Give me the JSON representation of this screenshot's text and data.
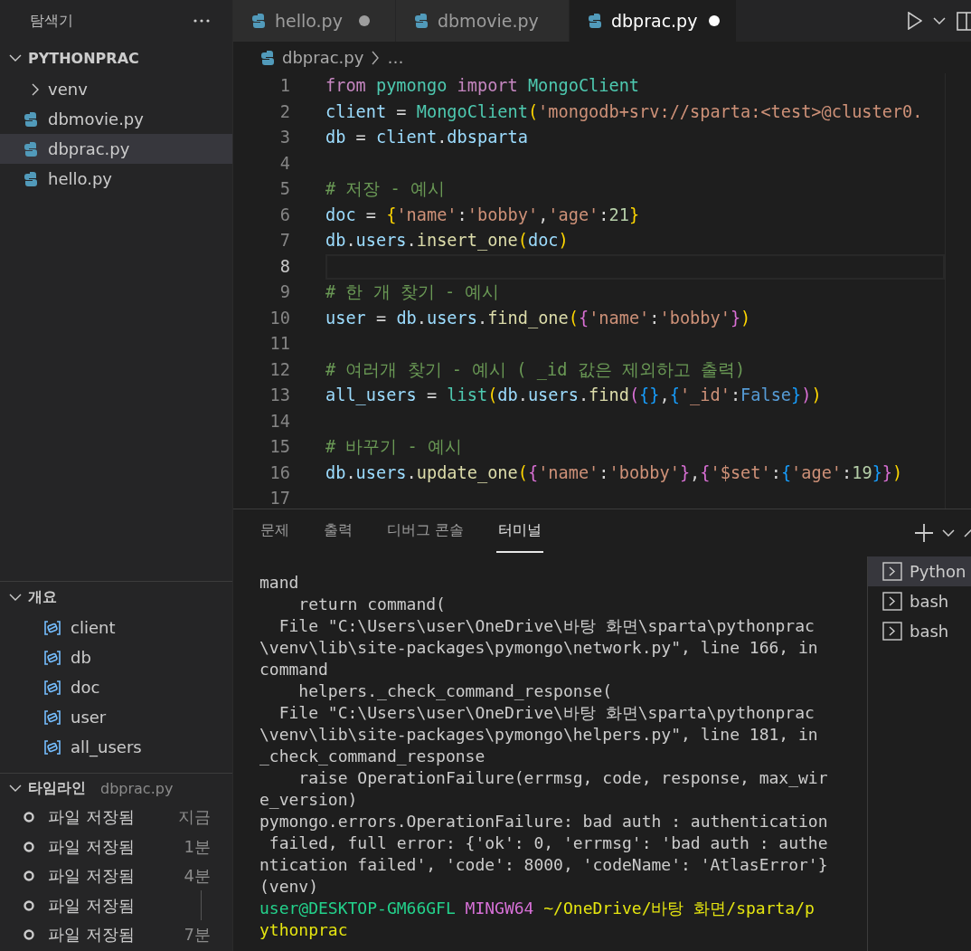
{
  "sidebar": {
    "title": "탐색기"
  },
  "explorer": {
    "folder": "PYTHONPRAC",
    "expanded": true,
    "items": [
      {
        "name": "venv",
        "kind": "folder",
        "expanded": false,
        "selected": false
      },
      {
        "name": "dbmovie.py",
        "kind": "file",
        "selected": false
      },
      {
        "name": "dbprac.py",
        "kind": "file",
        "selected": true
      },
      {
        "name": "hello.py",
        "kind": "file",
        "selected": false
      }
    ]
  },
  "outline": {
    "title": "개요",
    "expanded": true,
    "items": [
      "client",
      "db",
      "doc",
      "user",
      "all_users"
    ]
  },
  "timeline": {
    "title": "타임라인",
    "file": "dbprac.py",
    "expanded": true,
    "items": [
      {
        "label": "파일 저장됨",
        "kind": "time",
        "time": "지금"
      },
      {
        "label": "파일 저장됨",
        "kind": "time",
        "time": "1분"
      },
      {
        "label": "파일 저장됨",
        "kind": "time",
        "time": "4분"
      },
      {
        "label": "파일 저장됨",
        "kind": "span"
      },
      {
        "label": "파일 저장됨",
        "kind": "time",
        "time": "7분"
      }
    ]
  },
  "tabs": [
    {
      "label": "hello.py",
      "selected": false,
      "modified": true
    },
    {
      "label": "dbmovie.py",
      "selected": false,
      "modified": false
    },
    {
      "label": "dbprac.py",
      "selected": true,
      "modified": true
    }
  ],
  "breadcrumb": [
    "dbprac.py",
    "…"
  ],
  "code": [
    {
      "number": "1",
      "current": false,
      "tokens": [
        {
          "t": "from ",
          "kind": "kw"
        },
        {
          "t": "pymongo ",
          "kind": "cls"
        },
        {
          "t": "import ",
          "kind": "kw"
        },
        {
          "t": "MongoClient",
          "kind": "cls"
        }
      ]
    },
    {
      "number": "2",
      "current": false,
      "tokens": [
        {
          "t": "client",
          "kind": "var"
        },
        {
          "t": " = ",
          "kind": "op"
        },
        {
          "t": "MongoClient",
          "kind": "cls"
        },
        {
          "t": "(",
          "kind": "b1"
        },
        {
          "t": "'mongodb+srv://sparta:<test>@cluster0.",
          "kind": "str"
        }
      ]
    },
    {
      "number": "3",
      "current": false,
      "tokens": [
        {
          "t": "db",
          "kind": "var"
        },
        {
          "t": " = ",
          "kind": "op"
        },
        {
          "t": "client",
          "kind": "var"
        },
        {
          "t": ".",
          "kind": "op"
        },
        {
          "t": "dbsparta",
          "kind": "var"
        }
      ]
    },
    {
      "number": "4",
      "current": false
    },
    {
      "number": "5",
      "current": false,
      "tokens": [
        {
          "t": "# 저장 - 예시",
          "kind": "com"
        }
      ]
    },
    {
      "number": "6",
      "current": false,
      "tokens": [
        {
          "t": "doc",
          "kind": "var"
        },
        {
          "t": " = ",
          "kind": "op"
        },
        {
          "t": "{",
          "kind": "b1"
        },
        {
          "t": "'name'",
          "kind": "str"
        },
        {
          "t": ":",
          "kind": "op"
        },
        {
          "t": "'bobby'",
          "kind": "str"
        },
        {
          "t": ",",
          "kind": "op"
        },
        {
          "t": "'age'",
          "kind": "str"
        },
        {
          "t": ":",
          "kind": "op"
        },
        {
          "t": "21",
          "kind": "num"
        },
        {
          "t": "}",
          "kind": "b1"
        }
      ]
    },
    {
      "number": "7",
      "current": false,
      "tokens": [
        {
          "t": "db",
          "kind": "var"
        },
        {
          "t": ".",
          "kind": "op"
        },
        {
          "t": "users",
          "kind": "var"
        },
        {
          "t": ".",
          "kind": "op"
        },
        {
          "t": "insert_one",
          "kind": "fn"
        },
        {
          "t": "(",
          "kind": "b1"
        },
        {
          "t": "doc",
          "kind": "var"
        },
        {
          "t": ")",
          "kind": "b1"
        }
      ]
    },
    {
      "number": "8",
      "current": true
    },
    {
      "number": "9",
      "current": false,
      "tokens": [
        {
          "t": "# 한 개 찾기 - 예시",
          "kind": "com"
        }
      ]
    },
    {
      "number": "10",
      "current": false,
      "tokens": [
        {
          "t": "user",
          "kind": "var"
        },
        {
          "t": " = ",
          "kind": "op"
        },
        {
          "t": "db",
          "kind": "var"
        },
        {
          "t": ".",
          "kind": "op"
        },
        {
          "t": "users",
          "kind": "var"
        },
        {
          "t": ".",
          "kind": "op"
        },
        {
          "t": "find_one",
          "kind": "fn"
        },
        {
          "t": "(",
          "kind": "b1"
        },
        {
          "t": "{",
          "kind": "b2"
        },
        {
          "t": "'name'",
          "kind": "str"
        },
        {
          "t": ":",
          "kind": "op"
        },
        {
          "t": "'bobby'",
          "kind": "str"
        },
        {
          "t": "}",
          "kind": "b2"
        },
        {
          "t": ")",
          "kind": "b1"
        }
      ]
    },
    {
      "number": "11",
      "current": false
    },
    {
      "number": "12",
      "current": false,
      "tokens": [
        {
          "t": "# 여러개 찾기 - 예시 ( _id 값은 제외하고 출력)",
          "kind": "com"
        }
      ]
    },
    {
      "number": "13",
      "current": false,
      "tokens": [
        {
          "t": "all_users",
          "kind": "var"
        },
        {
          "t": " = ",
          "kind": "op"
        },
        {
          "t": "list",
          "kind": "cls"
        },
        {
          "t": "(",
          "kind": "b1"
        },
        {
          "t": "db",
          "kind": "var"
        },
        {
          "t": ".",
          "kind": "op"
        },
        {
          "t": "users",
          "kind": "var"
        },
        {
          "t": ".",
          "kind": "op"
        },
        {
          "t": "find",
          "kind": "fn"
        },
        {
          "t": "(",
          "kind": "b2"
        },
        {
          "t": "{}",
          "kind": "b3"
        },
        {
          "t": ",",
          "kind": "op"
        },
        {
          "t": "{",
          "kind": "b3"
        },
        {
          "t": "'_id'",
          "kind": "str"
        },
        {
          "t": ":",
          "kind": "op"
        },
        {
          "t": "False",
          "kind": "const"
        },
        {
          "t": "}",
          "kind": "b3"
        },
        {
          "t": ")",
          "kind": "b2"
        },
        {
          "t": ")",
          "kind": "b1"
        }
      ]
    },
    {
      "number": "14",
      "current": false
    },
    {
      "number": "15",
      "current": false,
      "tokens": [
        {
          "t": "# 바꾸기 - 예시",
          "kind": "com"
        }
      ]
    },
    {
      "number": "16",
      "current": false,
      "tokens": [
        {
          "t": "db",
          "kind": "var"
        },
        {
          "t": ".",
          "kind": "op"
        },
        {
          "t": "users",
          "kind": "var"
        },
        {
          "t": ".",
          "kind": "op"
        },
        {
          "t": "update_one",
          "kind": "fn"
        },
        {
          "t": "(",
          "kind": "b1"
        },
        {
          "t": "{",
          "kind": "b2"
        },
        {
          "t": "'name'",
          "kind": "str"
        },
        {
          "t": ":",
          "kind": "op"
        },
        {
          "t": "'bobby'",
          "kind": "str"
        },
        {
          "t": "}",
          "kind": "b2"
        },
        {
          "t": ",",
          "kind": "op"
        },
        {
          "t": "{",
          "kind": "b2"
        },
        {
          "t": "'$set'",
          "kind": "str"
        },
        {
          "t": ":",
          "kind": "op"
        },
        {
          "t": "{",
          "kind": "b3"
        },
        {
          "t": "'age'",
          "kind": "str"
        },
        {
          "t": ":",
          "kind": "op"
        },
        {
          "t": "19",
          "kind": "num"
        },
        {
          "t": "}",
          "kind": "b3"
        },
        {
          "t": "}",
          "kind": "b2"
        },
        {
          "t": ")",
          "kind": "b1"
        }
      ]
    },
    {
      "number": "17",
      "current": false
    }
  ],
  "panel": {
    "tabs": [
      {
        "label": "문제",
        "selected": false
      },
      {
        "label": "출력",
        "selected": false
      },
      {
        "label": "디버그 콘솔",
        "selected": false
      },
      {
        "label": "터미널",
        "selected": true
      }
    ],
    "terminal_lines": [
      [
        {
          "t": "mand",
          "kind": "out"
        }
      ],
      [
        {
          "t": "    return command(",
          "kind": "out"
        }
      ],
      [
        {
          "t": "  File \"C:\\Users\\user\\OneDrive\\바탕 화면\\sparta\\pythonprac",
          "kind": "out"
        }
      ],
      [
        {
          "t": "\\venv\\lib\\site-packages\\pymongo\\network.py\", line 166, in",
          "kind": "out"
        }
      ],
      [
        {
          "t": "command",
          "kind": "out"
        }
      ],
      [
        {
          "t": "    helpers._check_command_response(",
          "kind": "out"
        }
      ],
      [
        {
          "t": "  File \"C:\\Users\\user\\OneDrive\\바탕 화면\\sparta\\pythonprac",
          "kind": "out"
        }
      ],
      [
        {
          "t": "\\venv\\lib\\site-packages\\pymongo\\helpers.py\", line 181, in",
          "kind": "out"
        }
      ],
      [
        {
          "t": "_check_command_response",
          "kind": "out"
        }
      ],
      [
        {
          "t": "    raise OperationFailure(errmsg, code, response, max_wir",
          "kind": "out"
        }
      ],
      [
        {
          "t": "e_version)",
          "kind": "out"
        }
      ],
      [
        {
          "t": "pymongo.errors.OperationFailure: bad auth : authentication",
          "kind": "out"
        }
      ],
      [
        {
          "t": " failed, full error: {'ok': 0, 'errmsg': 'bad auth : authe",
          "kind": "out"
        }
      ],
      [
        {
          "t": "ntication failed', 'code': 8000, 'codeName': 'AtlasError'}",
          "kind": "out"
        }
      ],
      [
        {
          "t": "(venv)",
          "kind": "out"
        }
      ],
      [
        {
          "t": "user@DESKTOP-GM66GFL ",
          "kind": "user"
        },
        {
          "t": "MINGW64 ",
          "kind": "host"
        },
        {
          "t": "~/OneDrive/바탕 화면/sparta/p",
          "kind": "path"
        }
      ],
      [
        {
          "t": "ythonprac",
          "kind": "path"
        }
      ]
    ],
    "terminals": [
      {
        "label": "Python",
        "selected": true
      },
      {
        "label": "bash",
        "selected": false
      },
      {
        "label": "bash",
        "selected": false
      }
    ]
  }
}
